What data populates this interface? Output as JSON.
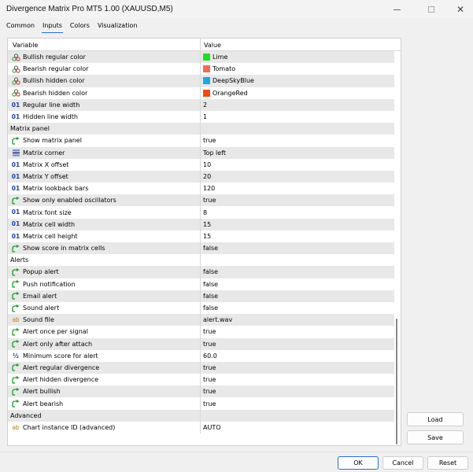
{
  "window": {
    "title": "Divergence Matrix Pro MT5 1.00 (XAUUSD,M5)",
    "minimize_glyph": "—",
    "close_glyph": "✕"
  },
  "tabs": [
    {
      "label": "Common",
      "active": false
    },
    {
      "label": "Inputs",
      "active": true
    },
    {
      "label": "Colors",
      "active": false
    },
    {
      "label": "Visualization",
      "active": false
    }
  ],
  "grid": {
    "headers": {
      "variable": "Variable",
      "value": "Value"
    },
    "rows": [
      {
        "icon": "color-icon",
        "label": "Bullish regular color",
        "value": "Lime",
        "swatch": "#22dd22"
      },
      {
        "icon": "color-icon",
        "label": "Bearish regular color",
        "value": "Tomato",
        "swatch": "#f26b50"
      },
      {
        "icon": "color-icon",
        "label": "Bullish hidden color",
        "value": "DeepSkyBlue",
        "swatch": "#1ea8e0"
      },
      {
        "icon": "color-icon",
        "label": "Bearish hidden color",
        "value": "OrangeRed",
        "swatch": "#f04a12"
      },
      {
        "icon": "integer-icon",
        "label": "Regular line width",
        "value": "2"
      },
      {
        "icon": "integer-icon",
        "label": "Hidden line width",
        "value": "1"
      },
      {
        "section": true,
        "label": "Matrix panel"
      },
      {
        "icon": "bool-icon",
        "label": "Show matrix panel",
        "value": "true"
      },
      {
        "icon": "enum-icon",
        "label": "Matrix corner",
        "value": "Top left"
      },
      {
        "icon": "integer-icon",
        "label": "Matrix X offset",
        "value": "10"
      },
      {
        "icon": "integer-icon",
        "label": "Matrix Y offset",
        "value": "20"
      },
      {
        "icon": "integer-icon",
        "label": "Matrix lookback bars",
        "value": "120"
      },
      {
        "icon": "bool-icon",
        "label": "Show only enabled oscillators",
        "value": "true"
      },
      {
        "icon": "integer-icon",
        "label": "Matrix font size",
        "value": "8"
      },
      {
        "icon": "integer-icon",
        "label": "Matrix cell width",
        "value": "15"
      },
      {
        "icon": "integer-icon",
        "label": "Matrix cell height",
        "value": "15"
      },
      {
        "icon": "bool-icon",
        "label": "Show score in matrix cells",
        "value": "false"
      },
      {
        "section": true,
        "label": "Alerts"
      },
      {
        "icon": "bool-icon",
        "label": "Popup alert",
        "value": "false"
      },
      {
        "icon": "bool-icon",
        "label": "Push notification",
        "value": "false"
      },
      {
        "icon": "bool-icon",
        "label": "Email alert",
        "value": "false"
      },
      {
        "icon": "bool-icon",
        "label": "Sound alert",
        "value": "false"
      },
      {
        "icon": "string-icon",
        "label": "Sound file",
        "value": "alert.wav"
      },
      {
        "icon": "bool-icon",
        "label": "Alert once per signal",
        "value": "true"
      },
      {
        "icon": "bool-icon",
        "label": "Alert only after attach",
        "value": "true"
      },
      {
        "icon": "double-icon",
        "label": "Minimum score for alert",
        "value": "60.0"
      },
      {
        "icon": "bool-icon",
        "label": "Alert regular divergence",
        "value": "true"
      },
      {
        "icon": "bool-icon",
        "label": "Alert hidden divergence",
        "value": "true"
      },
      {
        "icon": "bool-icon",
        "label": "Alert bullish",
        "value": "true"
      },
      {
        "icon": "bool-icon",
        "label": "Alert bearish",
        "value": "true"
      },
      {
        "section": true,
        "label": "Advanced"
      },
      {
        "icon": "string-icon",
        "label": "Chart instance ID (advanced)",
        "value": "AUTO"
      }
    ]
  },
  "side_buttons": {
    "load": "Load",
    "save": "Save"
  },
  "footer_buttons": {
    "ok": "OK",
    "cancel": "Cancel",
    "reset": "Reset"
  },
  "icon_glyphs": {
    "integer": "01",
    "string": "ab",
    "double": "½"
  },
  "colors": {
    "accent": "#2d6cd6",
    "bool_icon": "#1a9a2a",
    "integer_icon": "#1b3f9e",
    "string_icon": "#b87a14"
  }
}
